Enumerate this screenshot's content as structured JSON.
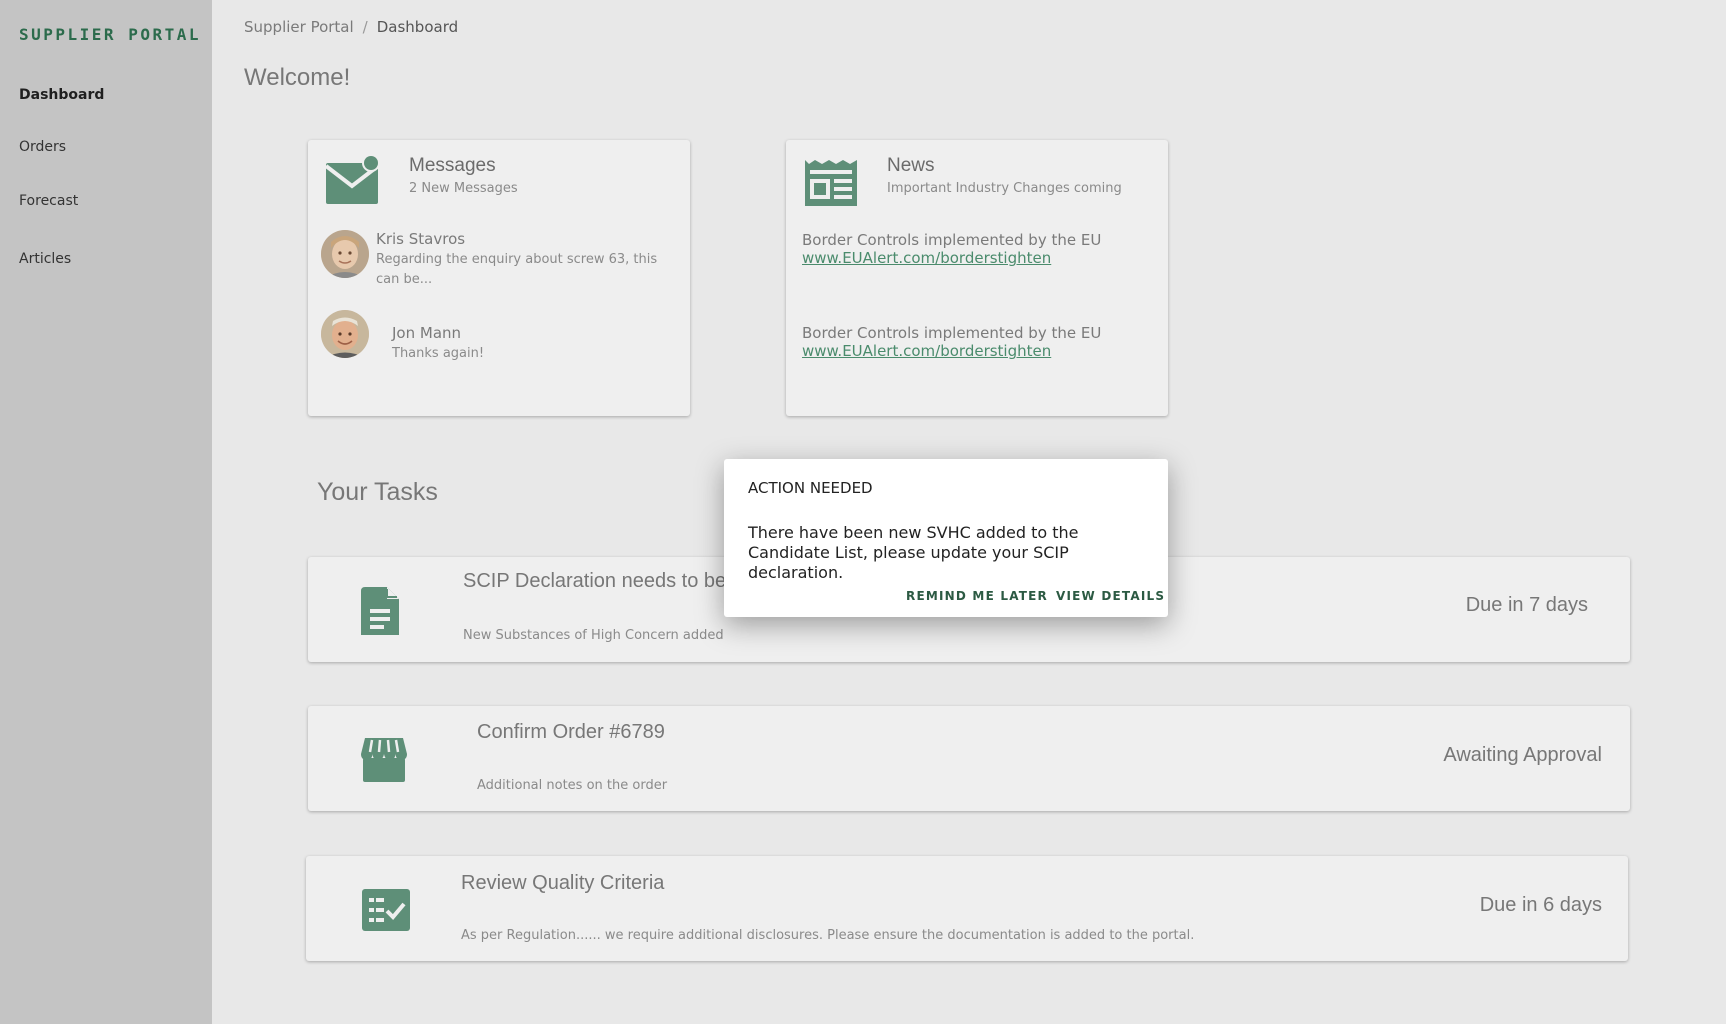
{
  "sidebar": {
    "brand": "SUPPLIER PORTAL",
    "items": [
      {
        "label": "Dashboard"
      },
      {
        "label": "Orders"
      },
      {
        "label": "Forecast"
      },
      {
        "label": "Articles"
      }
    ]
  },
  "breadcrumb": {
    "root": "Supplier Portal",
    "separator": "/",
    "current": "Dashboard"
  },
  "welcome": "Welcome!",
  "messages": {
    "title": "Messages",
    "subtitle": "2 New Messages",
    "items": [
      {
        "name": "Kris Stavros",
        "preview": "Regarding the enquiry about screw 63, this can be..."
      },
      {
        "name": "Jon Mann",
        "preview": "Thanks again!"
      }
    ]
  },
  "news": {
    "title": "News",
    "subtitle": "Important Industry Changes coming",
    "items": [
      {
        "text": "Border Controls implemented by the EU",
        "link": "www.EUAlert.com/borderstighten"
      },
      {
        "text": "Border Controls implemented by the EU",
        "link": "www.EUAlert.com/borderstighten"
      }
    ]
  },
  "tasks": {
    "title": "Your Tasks",
    "items": [
      {
        "title": "SCIP Declaration needs to be",
        "subtitle": "New Substances of High Concern added",
        "status": "Due in 7 days"
      },
      {
        "title": "Confirm Order #6789",
        "subtitle": "Additional notes on the order",
        "status": "Awaiting Approval"
      },
      {
        "title": "Review Quality Criteria",
        "subtitle": "As per Regulation...... we require additional disclosures. Please ensure the documentation is added to the portal.",
        "status": "Due in 6 days"
      }
    ]
  },
  "modal": {
    "title": "ACTION NEEDED",
    "body": "There have been new SVHC added to the Candidate List, please update your SCIP declaration.",
    "remind_label": "REMIND ME LATER",
    "view_label": "VIEW DETAILS"
  },
  "colors": {
    "accent": "#5e8f78",
    "brand": "#2c6b4c",
    "sidebar_bg": "#c4c4c4",
    "page_bg": "#e8e8e8"
  },
  "icons": {
    "messages": "mail-notification-icon",
    "news": "newspaper-icon",
    "task_1": "document-icon",
    "task_2": "storefront-icon",
    "task_3": "checklist-icon"
  }
}
